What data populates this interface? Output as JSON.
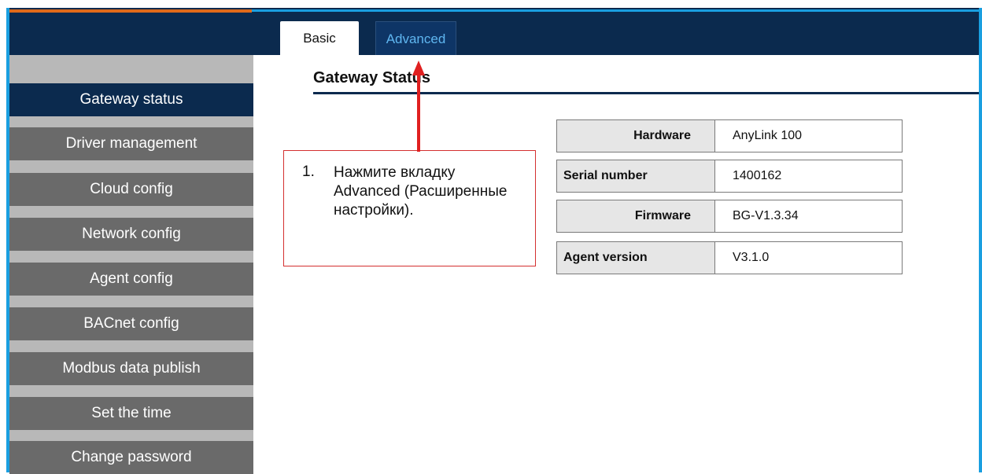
{
  "tabs": [
    {
      "label": "Basic"
    },
    {
      "label": "Advanced"
    }
  ],
  "sidebar": {
    "items": [
      {
        "label": "Gateway status",
        "active": true
      },
      {
        "label": "Driver management"
      },
      {
        "label": "Cloud config"
      },
      {
        "label": "Network config"
      },
      {
        "label": "Agent config"
      },
      {
        "label": "BACnet config"
      },
      {
        "label": "Modbus data publish"
      },
      {
        "label": "Set the time"
      },
      {
        "label": "Change password"
      }
    ]
  },
  "main": {
    "title": "Gateway Status",
    "rows": [
      {
        "key": "Hardware",
        "value": "AnyLink 100"
      },
      {
        "key": "Serial number",
        "value": "1400162"
      },
      {
        "key": "Firmware",
        "value": "BG-V1.3.34"
      },
      {
        "key": "Agent version",
        "value": "V3.1.0"
      }
    ]
  },
  "callout": {
    "number": "1.",
    "text": "Нажмите вкладку Advanced (Расширенные настройки)."
  },
  "colors": {
    "header_bg": "#0b2a4e",
    "sidebar_item": "#6a6a6a",
    "accent_blue": "#1a9fe0",
    "accent_orange": "#e06a1a",
    "callout_red": "#d43030"
  }
}
